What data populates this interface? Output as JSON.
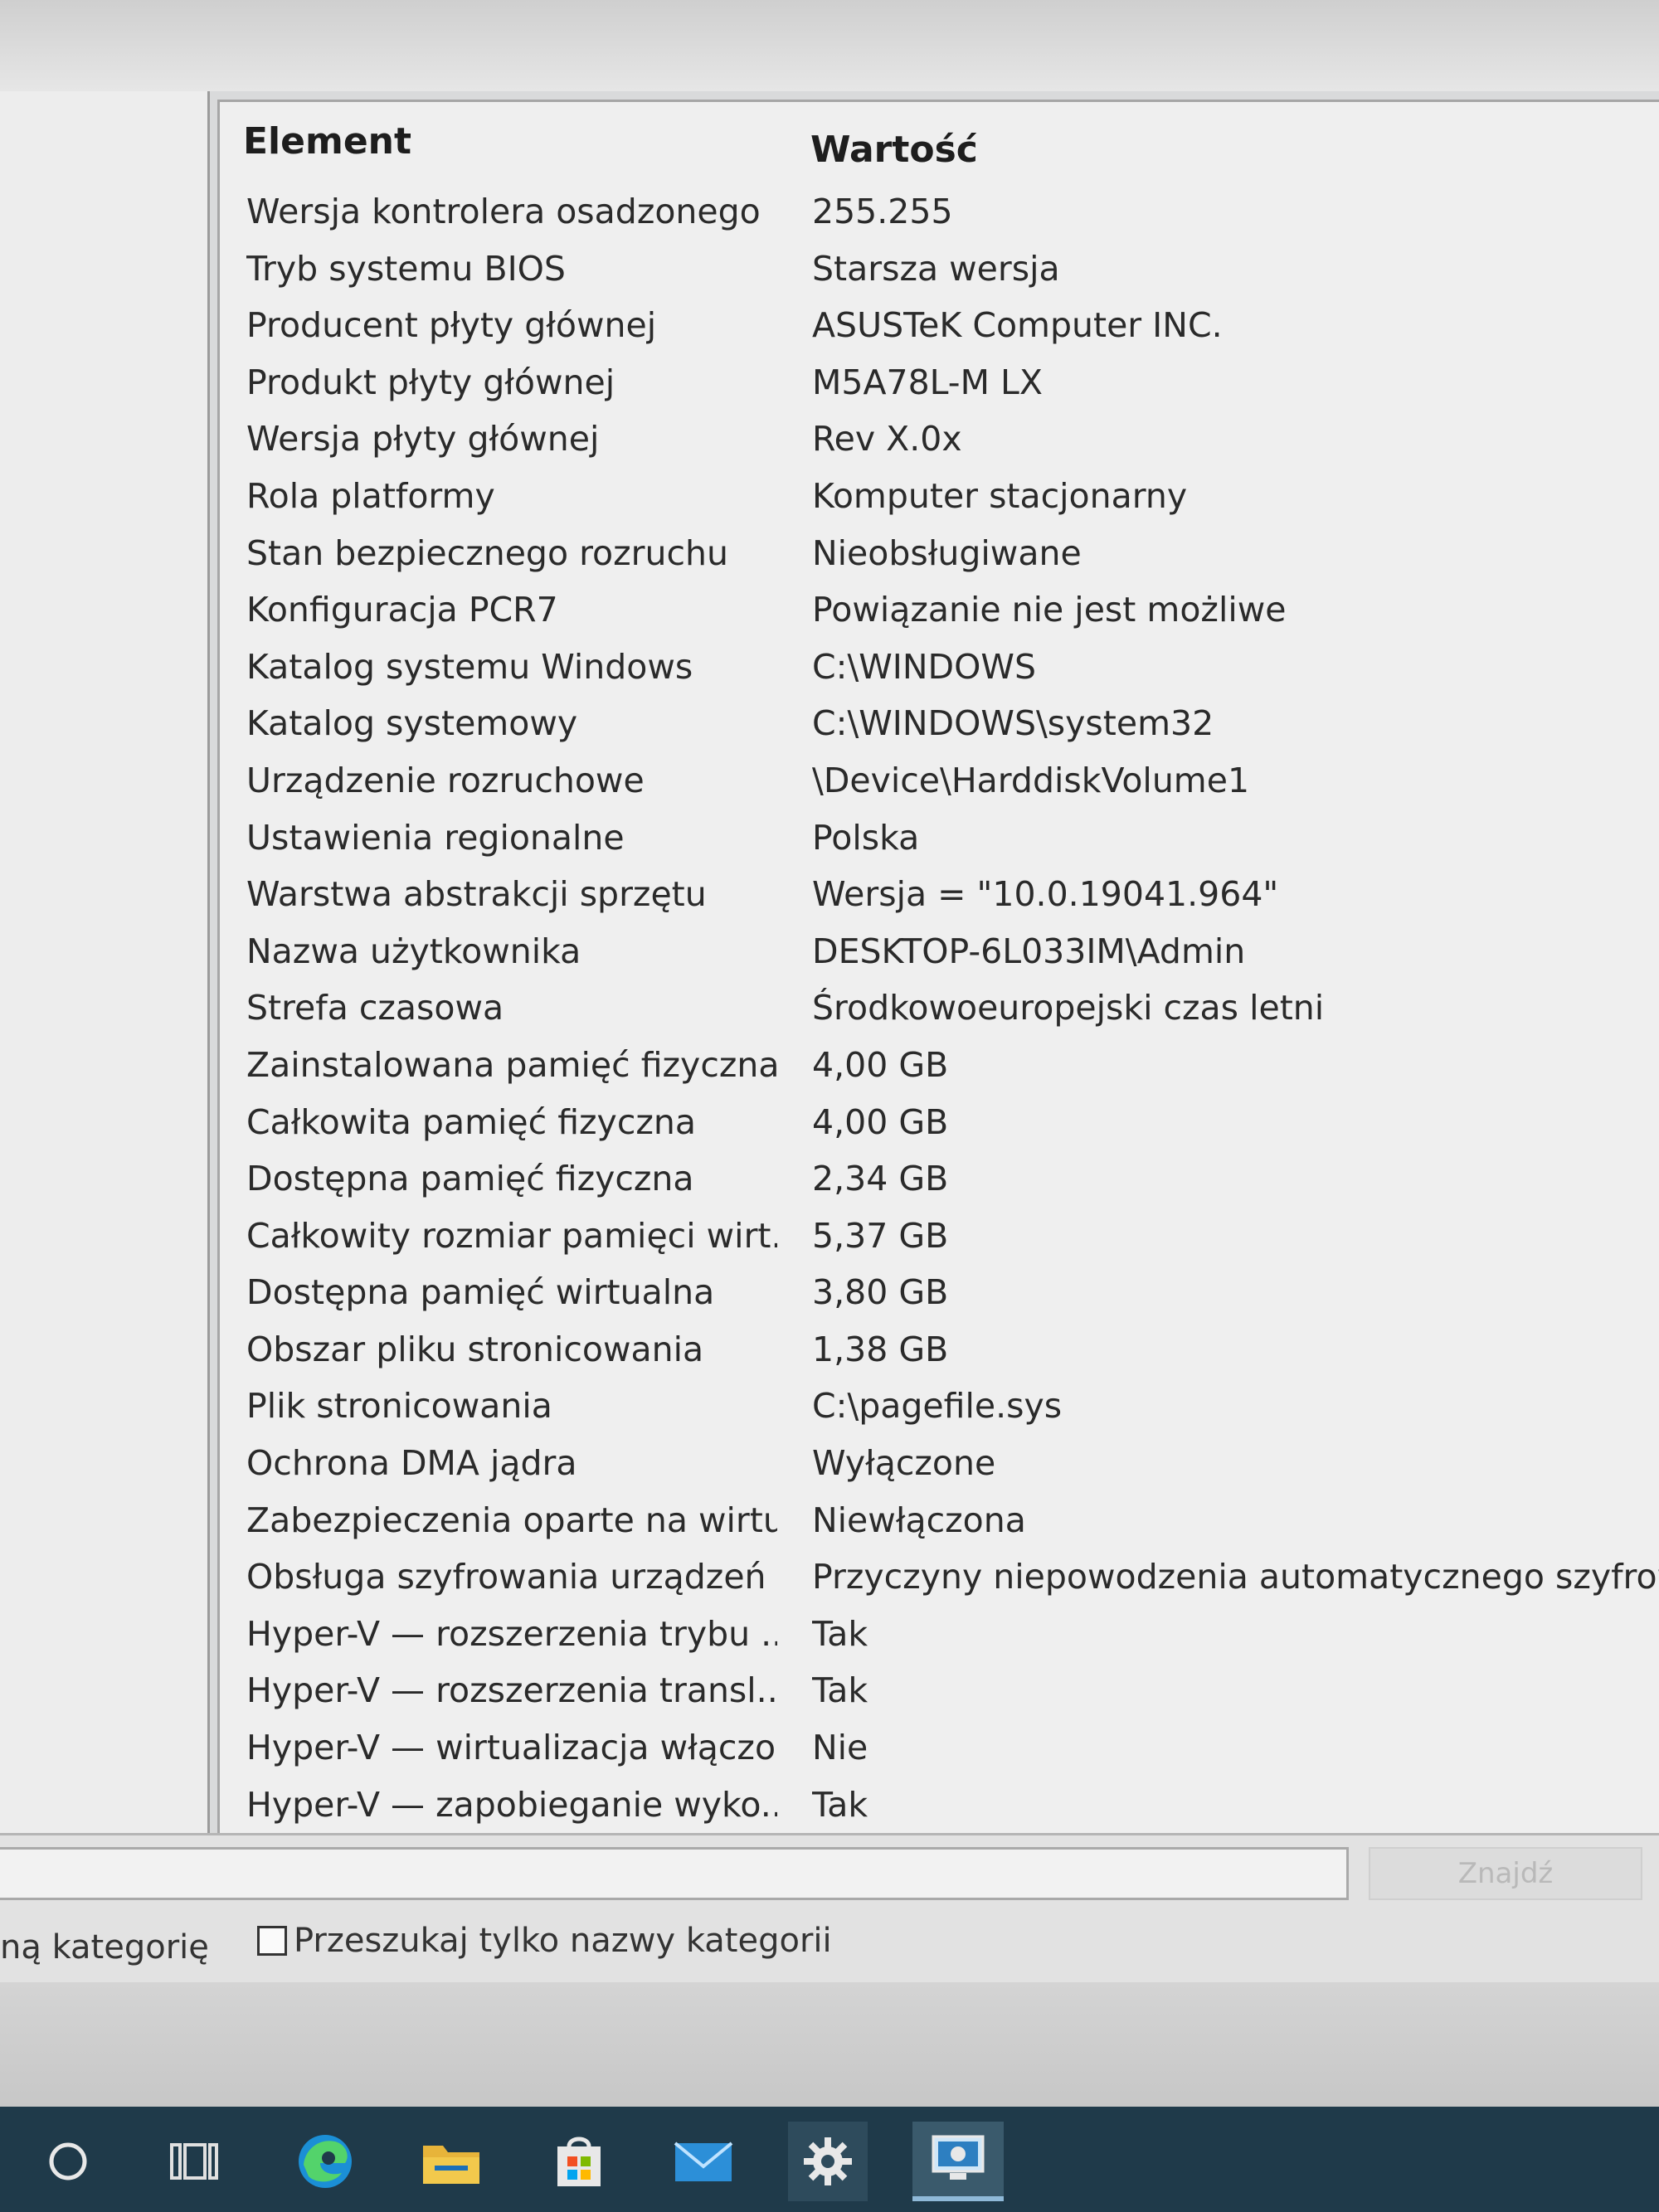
{
  "list": {
    "headers": {
      "element": "Element",
      "value": "Wartość"
    },
    "rows": [
      {
        "name": "Wersja kontrolera osadzonego",
        "value": "255.255"
      },
      {
        "name": "Tryb systemu BIOS",
        "value": "Starsza wersja"
      },
      {
        "name": "Producent płyty głównej",
        "value": "ASUSTeK Computer INC."
      },
      {
        "name": "Produkt płyty głównej",
        "value": "M5A78L-M LX"
      },
      {
        "name": "Wersja płyty głównej",
        "value": "Rev X.0x"
      },
      {
        "name": "Rola platformy",
        "value": "Komputer stacjonarny"
      },
      {
        "name": "Stan bezpiecznego rozruchu",
        "value": "Nieobsługiwane"
      },
      {
        "name": "Konfiguracja PCR7",
        "value": "Powiązanie nie jest możliwe"
      },
      {
        "name": "Katalog systemu Windows",
        "value": "C:\\WINDOWS"
      },
      {
        "name": "Katalog systemowy",
        "value": "C:\\WINDOWS\\system32"
      },
      {
        "name": "Urządzenie rozruchowe",
        "value": "\\Device\\HarddiskVolume1"
      },
      {
        "name": "Ustawienia regionalne",
        "value": "Polska"
      },
      {
        "name": "Warstwa abstrakcji sprzętu",
        "value": "Wersja = \"10.0.19041.964\""
      },
      {
        "name": "Nazwa użytkownika",
        "value": "DESKTOP-6L033IM\\Admin"
      },
      {
        "name": "Strefa czasowa",
        "value": "Środkowoeuropejski czas letni"
      },
      {
        "name": "Zainstalowana pamięć fizyczna ...",
        "value": "4,00 GB"
      },
      {
        "name": "Całkowita pamięć fizyczna",
        "value": "4,00 GB"
      },
      {
        "name": "Dostępna pamięć fizyczna",
        "value": "2,34 GB"
      },
      {
        "name": "Całkowity rozmiar pamięci wirt...",
        "value": "5,37 GB"
      },
      {
        "name": "Dostępna pamięć wirtualna",
        "value": "3,80 GB"
      },
      {
        "name": "Obszar pliku stronicowania",
        "value": "1,38 GB"
      },
      {
        "name": "Plik stronicowania",
        "value": "C:\\pagefile.sys"
      },
      {
        "name": "Ochrona DMA jądra",
        "value": "Wyłączone"
      },
      {
        "name": "Zabezpieczenia oparte na wirtu...",
        "value": "Niewłączona"
      },
      {
        "name": "Obsługa szyfrowania urządzeń",
        "value": "Przyczyny niepowodzenia automatycznego szyfrowania ur"
      },
      {
        "name": "Hyper-V — rozszerzenia trybu ...",
        "value": "Tak"
      },
      {
        "name": "Hyper-V — rozszerzenia transl...",
        "value": "Tak"
      },
      {
        "name": "Hyper-V — wirtualizacja włączo...",
        "value": "Nie"
      },
      {
        "name": "Hyper-V — zapobieganie wyko...",
        "value": "Tak"
      }
    ]
  },
  "search": {
    "input_value": "",
    "find_label": "Znajdź",
    "selected_category_label": "ną kategorię",
    "category_names_only_label": "Przeszukaj tylko nazwy kategorii"
  },
  "taskbar": {
    "icons": [
      "cortana-circle-icon",
      "task-view-icon",
      "edge-icon",
      "file-explorer-icon",
      "store-icon",
      "mail-icon",
      "settings-gear-icon",
      "system-info-app-icon"
    ],
    "colors": {
      "background": "#1f3a4a",
      "active_indicator": "#8fb9d8"
    }
  }
}
